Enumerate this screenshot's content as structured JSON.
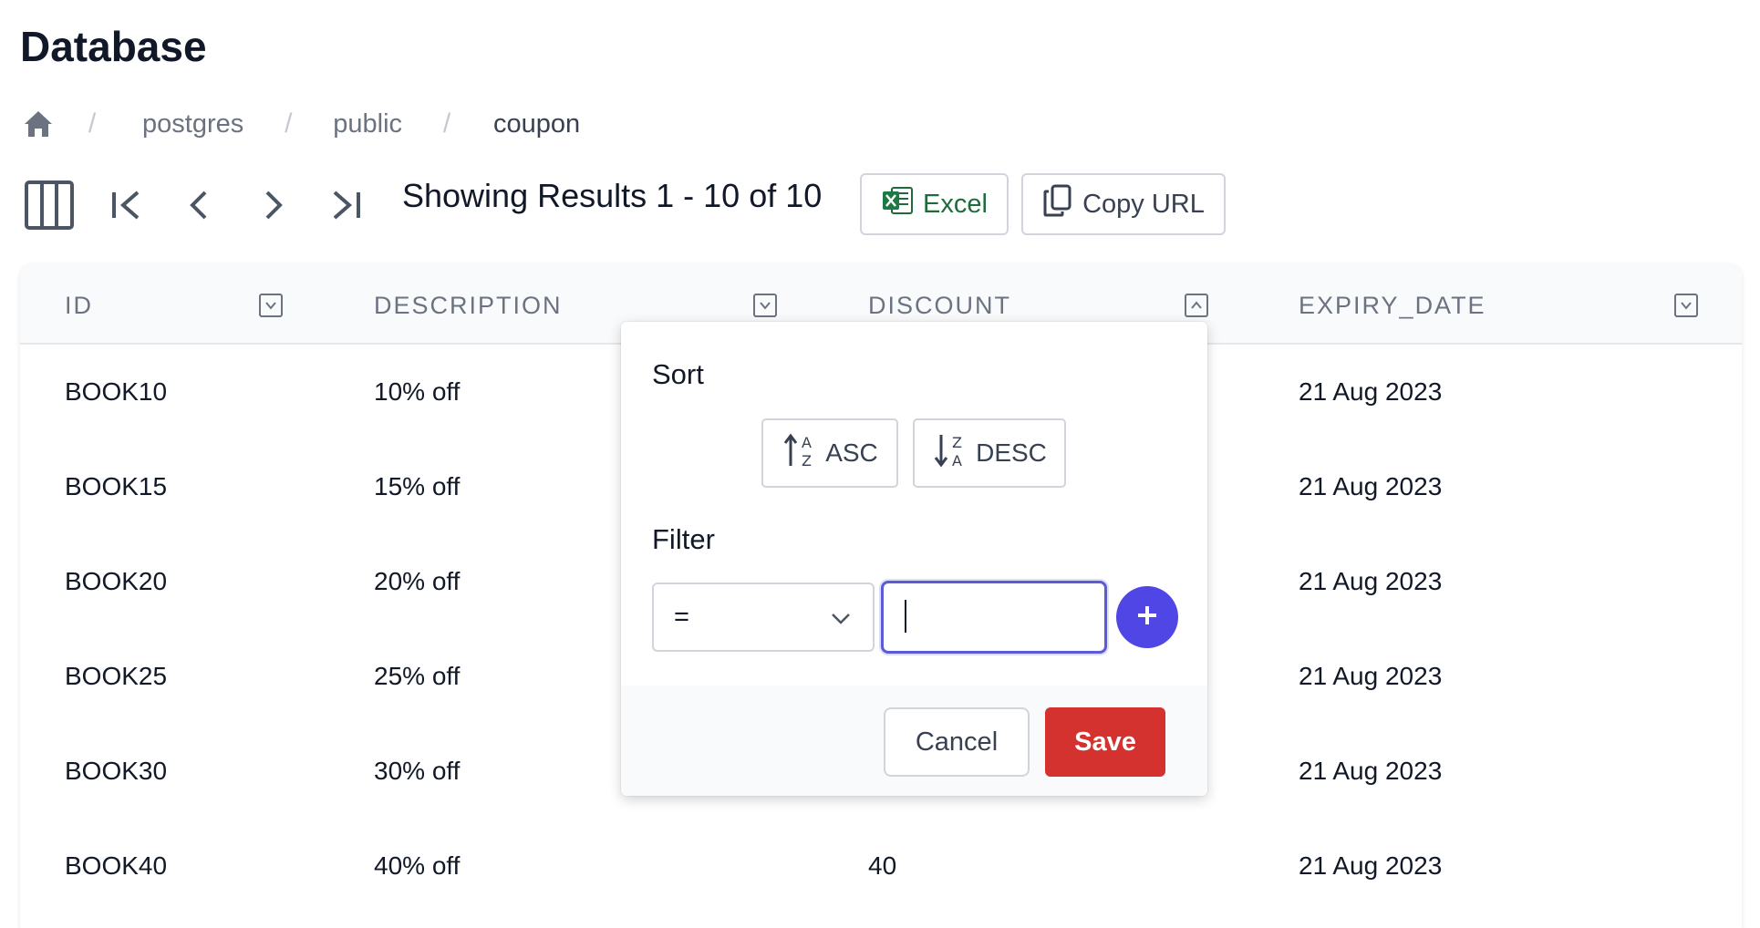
{
  "page": {
    "title": "Database"
  },
  "breadcrumb": {
    "separator": "/",
    "items": [
      "postgres",
      "public",
      "coupon"
    ]
  },
  "toolbar": {
    "results_text": "Showing Results 1 - 10 of 10",
    "excel_label": "Excel",
    "copy_url_label": "Copy URL",
    "icons": [
      "columns-icon",
      "first-page-icon",
      "prev-page-icon",
      "next-page-icon",
      "last-page-icon"
    ]
  },
  "table": {
    "columns": [
      "ID",
      "DESCRIPTION",
      "DISCOUNT",
      "EXPIRY_DATE"
    ],
    "rows": [
      {
        "id": "BOOK10",
        "description": "10% off",
        "discount": "",
        "expiry_date": "21 Aug 2023"
      },
      {
        "id": "BOOK15",
        "description": "15% off",
        "discount": "",
        "expiry_date": "21 Aug 2023"
      },
      {
        "id": "BOOK20",
        "description": "20% off",
        "discount": "",
        "expiry_date": "21 Aug 2023"
      },
      {
        "id": "BOOK25",
        "description": "25% off",
        "discount": "",
        "expiry_date": "21 Aug 2023"
      },
      {
        "id": "BOOK30",
        "description": "30% off",
        "discount": "",
        "expiry_date": "21 Aug 2023"
      },
      {
        "id": "BOOK40",
        "description": "40% off",
        "discount": "40",
        "expiry_date": "21 Aug 2023"
      }
    ]
  },
  "popover": {
    "sort_heading": "Sort",
    "asc_label": "ASC",
    "desc_label": "DESC",
    "filter_heading": "Filter",
    "operator_value": "=",
    "filter_value": "",
    "cancel_label": "Cancel",
    "save_label": "Save"
  },
  "colors": {
    "accent": "#4f46e5",
    "save": "#d3322f",
    "excel": "#1f6b3c",
    "muted_text": "#6b7280"
  }
}
